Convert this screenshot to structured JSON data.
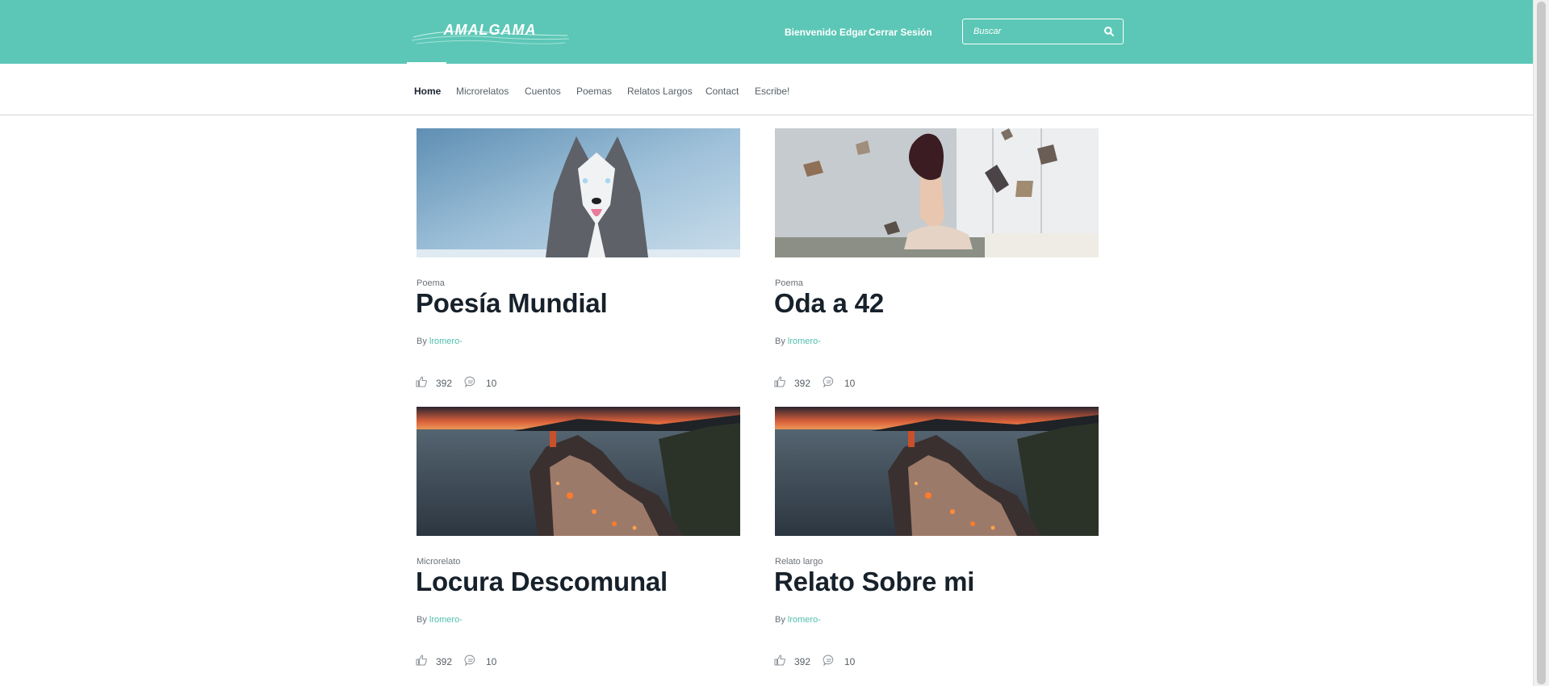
{
  "header": {
    "logo_text": "AMALGAMA",
    "greeting": "Bienvenido Edgar",
    "logout_label": "Cerrar Sesión",
    "search_placeholder": "Buscar",
    "search_icon": "search-icon",
    "background_color": "#5cc7b6"
  },
  "nav": {
    "items": [
      {
        "label": "Home",
        "active": true
      },
      {
        "label": "Microrelatos",
        "active": false
      },
      {
        "label": "Cuentos",
        "active": false
      },
      {
        "label": "Poemas",
        "active": false
      },
      {
        "label": "Relatos Largos",
        "active": false
      },
      {
        "label": "Contact",
        "active": false
      },
      {
        "label": "Escribe!",
        "active": false
      }
    ]
  },
  "posts": [
    {
      "category": "Poema",
      "title": "Poesía Mundial",
      "by_label": "By",
      "author": "lromero-",
      "likes": "392",
      "comments": "10",
      "image": "husky-dog-snow"
    },
    {
      "category": "Poema",
      "title": "Oda a 42",
      "by_label": "By",
      "author": "lromero-",
      "likes": "392",
      "comments": "10",
      "image": "woman-flying-books"
    },
    {
      "category": "Microrelato",
      "title": "Locura Descomunal",
      "by_label": "By",
      "author": "lromero-",
      "likes": "392",
      "comments": "10",
      "image": "coastal-village-sunset"
    },
    {
      "category": "Relato largo",
      "title": "Relato Sobre mi",
      "by_label": "By",
      "author": "lromero-",
      "likes": "392",
      "comments": "10",
      "image": "coastal-village-sunset"
    }
  ],
  "icons": {
    "like": "thumbs-up-icon",
    "comment": "comment-icon"
  },
  "colors": {
    "accent": "#5cc7b6",
    "author_link": "#4fbfae",
    "title": "#17212b"
  }
}
